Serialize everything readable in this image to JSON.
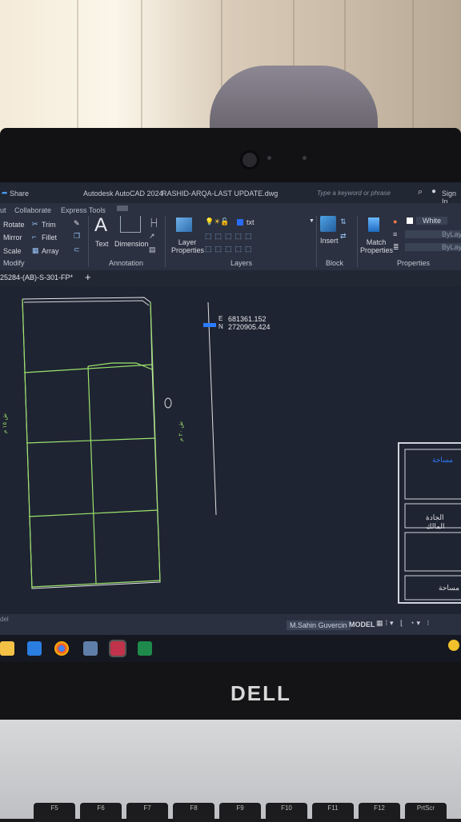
{
  "titlebar": {
    "share_label": "Share",
    "app_title": "Autodesk AutoCAD 2024",
    "file_title": "RASHID-ARQA-LAST UPDATE.dwg",
    "search_placeholder": "Type a keyword or phrase",
    "signin_label": "Sign In"
  },
  "ribbon": {
    "tabs": [
      "ut",
      "Collaborate",
      "Express Tools"
    ],
    "modify": {
      "rotate": "Rotate",
      "trim": "Trim",
      "mirror": "Mirror",
      "fillet": "Fillet",
      "scale": "Scale",
      "array": "Array",
      "panel_label": "Modify"
    },
    "annotation": {
      "text": "Text",
      "dimension": "Dimension",
      "panel_label": "Annotation"
    },
    "layers": {
      "layer_properties": "Layer Properties",
      "current_layer": "txt",
      "panel_label": "Layers"
    },
    "block": {
      "insert": "Insert",
      "panel_label": "Block"
    },
    "properties": {
      "match_properties": "Match Properties",
      "color_value": "White",
      "linetype_value": "ByLayer",
      "lineweight_value": "ByLayer",
      "panel_label": "Properties"
    }
  },
  "filetab": {
    "name": "25284-(AB)-S-301-FP*",
    "add_label": "+"
  },
  "drawing": {
    "coord_e": "681361.152",
    "coord_n": "2720905.424",
    "e_label": "E",
    "n_label": "N",
    "table_rows": [
      "مساحة",
      "الجادة المالك",
      "",
      "مساحة"
    ]
  },
  "statusbar": {
    "left_text": "del",
    "user": "M.Sahin Guvercin",
    "space": "MODEL"
  },
  "taskbar": {
    "icons": [
      "file-explorer-icon",
      "mail-icon",
      "chrome-icon",
      "calculator-icon",
      "autocad-icon",
      "excel-icon"
    ]
  },
  "laptop": {
    "brand": "DELL"
  },
  "keyboard": {
    "keys": [
      "F5",
      "F6",
      "F7",
      "F8",
      "F9",
      "F10",
      "F11",
      "F12",
      "PrtScr"
    ]
  },
  "colors": {
    "canvas": "#1f2433",
    "drawing_lines": "#9be36a",
    "screen_chrome": "#2b3140"
  }
}
